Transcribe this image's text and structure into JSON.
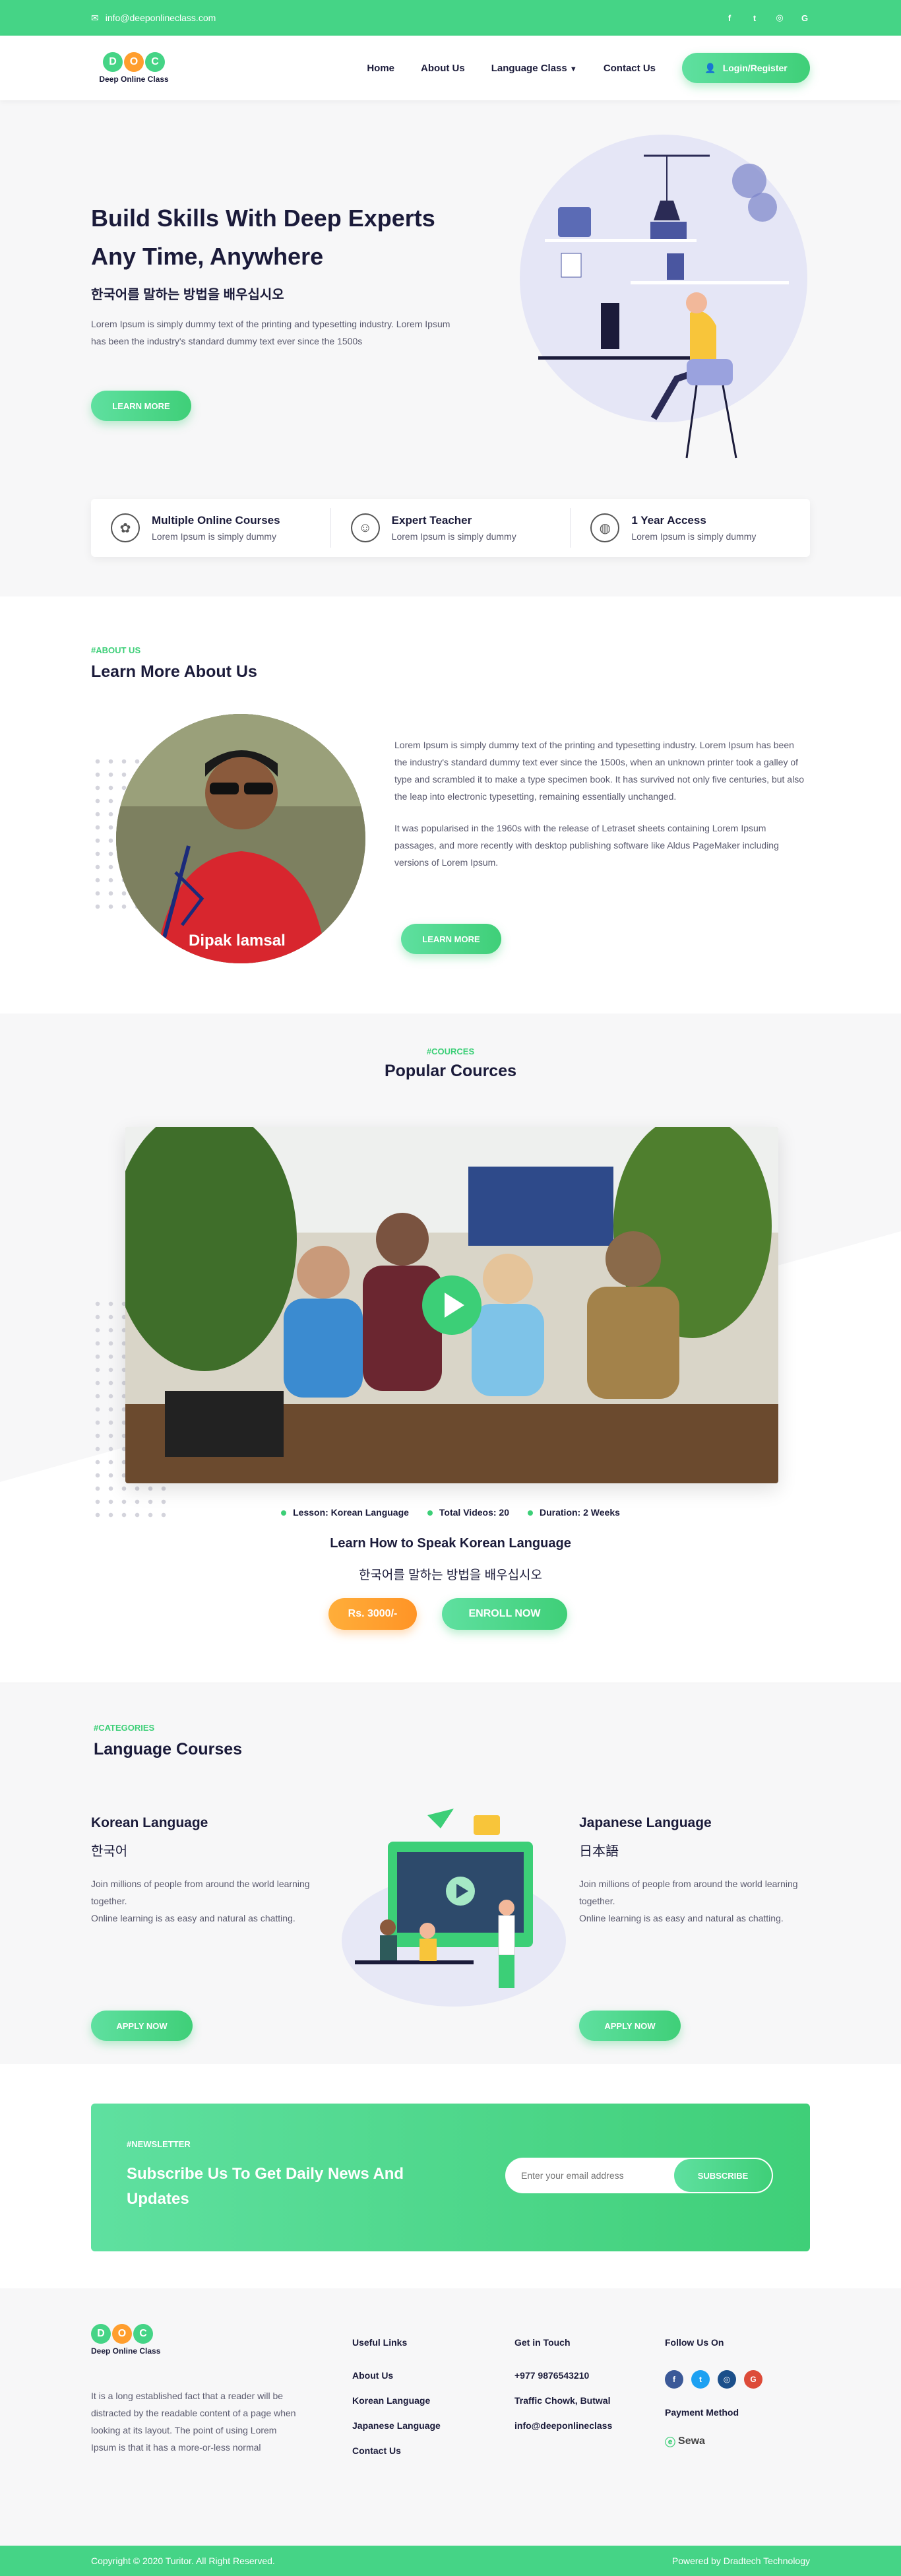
{
  "topbar": {
    "email": "info@deeponlineclass.com",
    "socials": [
      "facebook-icon",
      "twitter-icon",
      "instagram-icon",
      "google-icon"
    ]
  },
  "brand": {
    "letters": [
      "D",
      "O",
      "C"
    ],
    "name": "Deep Online Class",
    "colors": {
      "primary": "#45d486",
      "orange": "#ff9e2e",
      "dark": "#1b1b3a"
    }
  },
  "nav": {
    "items": [
      "Home",
      "About Us",
      "Language Class",
      "Contact Us"
    ],
    "login_label": "Login/Register"
  },
  "hero": {
    "title_line1": "Build Skills With Deep Experts",
    "title_line2": "Any Time, Anywhere",
    "korean": "한국어를 말하는 방법을 배우십시오",
    "desc": "Lorem Ipsum is simply dummy text of the printing and typesetting industry. Lorem Ipsum has been the industry's standard dummy text ever since the 1500s",
    "cta": "LEARN MORE"
  },
  "features": [
    {
      "icon": "brain-icon",
      "title": "Multiple Online Courses",
      "desc": "Lorem Ipsum is simply dummy"
    },
    {
      "icon": "team-icon",
      "title": "Expert Teacher",
      "desc": "Lorem Ipsum is simply dummy"
    },
    {
      "icon": "globe-icon",
      "title": "1 Year Access",
      "desc": "Lorem Ipsum is simply dummy"
    }
  ],
  "about": {
    "tag": "#ABOUT US",
    "title": "Learn More About Us",
    "photo_caption": "Dipak lamsal",
    "para1": "Lorem Ipsum is simply dummy text of the printing and typesetting industry. Lorem Ipsum has been the industry's standard dummy text ever since the 1500s, when an unknown printer took a galley of type and scrambled it to make a type specimen book. It has survived not only five centuries, but also the leap into electronic typesetting, remaining essentially unchanged.",
    "para2": "It was popularised in the 1960s with the release of Letraset sheets containing Lorem Ipsum passages, and more recently with desktop publishing software like Aldus PageMaker including versions of Lorem Ipsum.",
    "cta": "LEARN MORE"
  },
  "courses": {
    "tag": "#COURCES",
    "title": "Popular Cources",
    "meta": [
      "Lesson: Korean Language",
      "Total Videos: 20",
      "Duration: 2 Weeks"
    ],
    "course_title": "Learn How to Speak Korean Language",
    "course_ko": "한국어를 말하는 방법을 배우십시오",
    "price": "Rs. 3000/-",
    "enroll": "ENROLL NOW"
  },
  "categories": {
    "tag": "#CATEGORIES",
    "title": "Language Courses",
    "items": [
      {
        "name": "Korean Language",
        "native": "한국어",
        "line1": "Join millions of people from around the world learning together.",
        "line2": "Online learning is as easy and natural as chatting.",
        "cta": "APPLY NOW"
      },
      {
        "name": "Japanese Language",
        "native": "日本語",
        "line1": "Join millions of people from around the world learning together.",
        "line2": "Online learning is as easy and natural as chatting.",
        "cta": "APPLY NOW"
      }
    ]
  },
  "newsletter": {
    "tag": "#NEWSLETTER",
    "title": "Subscribe Us To Get Daily News And Updates",
    "placeholder": "Enter your email address",
    "button": "SUBSCRIBE"
  },
  "footer": {
    "about": "It is a long established fact that a reader will be distracted by the readable content of a page when looking at its layout. The point of using Lorem Ipsum is that it has a more-or-less normal distribution of letters,",
    "useful_title": "Useful Links",
    "useful_links": [
      "About Us",
      "Korean Language",
      "Japanese Language",
      "Contact Us"
    ],
    "touch_title": "Get in Touch",
    "touch": [
      "+977 9876543210",
      "Traffic Chowk, Butwal",
      "info@deeponlineclass"
    ],
    "follow_title": "Follow Us On",
    "payment_title": "Payment Method",
    "payment": "Sewa",
    "copyright": "Copyright © 2020 Turitor. All Right Reserved.",
    "powered": "Powered by Dradtech Technology"
  }
}
